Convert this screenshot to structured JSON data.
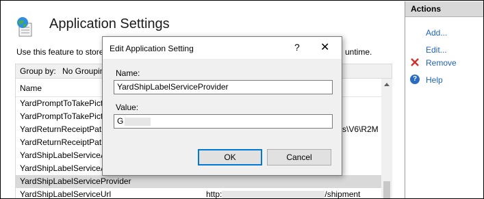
{
  "page": {
    "title": "Application Settings",
    "description_left": "Use this feature to store",
    "description_right": "untime."
  },
  "groupby": {
    "label": "Group by:",
    "value": "No Groupin"
  },
  "grid": {
    "column_name": "Name",
    "rows": [
      {
        "name": "YardPromptToTakePictu",
        "value": ""
      },
      {
        "name": "YardPromptToTakePictu",
        "value": ""
      },
      {
        "name": "YardReturnReceiptPath",
        "value": "s\\V6\\R2M"
      },
      {
        "name": "YardReturnReceiptPath",
        "value": ""
      },
      {
        "name": "YardShipLabelServiceAp",
        "value": ""
      },
      {
        "name": "YardShipLabelServiceAp",
        "value": ""
      },
      {
        "name": "YardShipLabelServiceProvider",
        "value": ""
      },
      {
        "name": "YardShipLabelServiceUrl",
        "value_prefix": "http:",
        "value_suffix": "/shipment"
      }
    ]
  },
  "actions": {
    "header": "Actions",
    "add": "Add...",
    "edit": "Edit...",
    "remove": "Remove",
    "help": "Help"
  },
  "dialog": {
    "title": "Edit Application Setting",
    "help_glyph": "?",
    "close_glyph": "✕",
    "name_label": "Name:",
    "name_value": "YardShipLabelServiceProvider",
    "value_label": "Value:",
    "value_value": "G",
    "ok_label": "OK",
    "cancel_label": "Cancel"
  },
  "colors": {
    "link": "#1f63b7",
    "selected_row": "#d9d9d9",
    "focus_border": "#0078d7"
  },
  "icons": [
    "application-settings-icon",
    "remove-icon",
    "help-icon",
    "close-icon"
  ]
}
